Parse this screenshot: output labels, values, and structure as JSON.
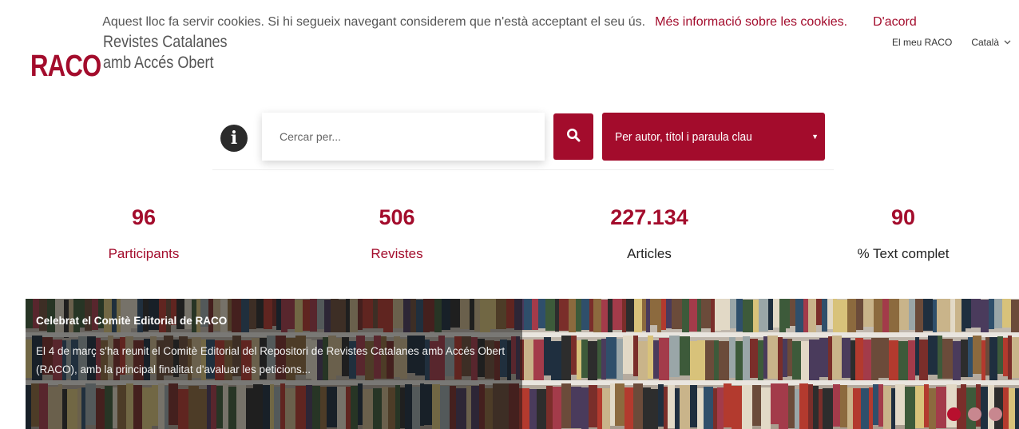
{
  "header": {
    "logo": "RACO",
    "tagline_line1": "Revistes Catalanes",
    "tagline_line2": "amb Accés Obert",
    "my_raco": "El meu RACO",
    "language": "Català"
  },
  "cookie_bar": {
    "message": "Aquest lloc fa servir cookies. Si hi segueix navegant considerem que n'està acceptant el seu ús.",
    "more_info_link": "Més informació sobre les cookies.",
    "accept_label": "D'acord"
  },
  "search": {
    "placeholder": "Cercar per...",
    "selected_option": "Per autor, títol i paraula clau"
  },
  "stats": [
    {
      "value": "96",
      "label": "Participants"
    },
    {
      "value": "506",
      "label": "Revistes"
    },
    {
      "value": "227.134",
      "label": "Articles"
    },
    {
      "value": "90",
      "label": "% Text complet"
    }
  ],
  "banner": {
    "title": "Celebrat el Comitè Editorial de RACO",
    "text": "El 4 de març s'ha reunit el Comitè Editorial del Repositori de Revistes Catalanes amb Accés Obert (RACO), amb la principal finalitat d'avaluar les peticions...",
    "slide_count": 3,
    "active_slide": 1
  },
  "colors": {
    "accent": "#a30c2c"
  },
  "icons": [
    "info-icon",
    "search-icon",
    "caret-down-icon",
    "chevron-down-icon"
  ]
}
